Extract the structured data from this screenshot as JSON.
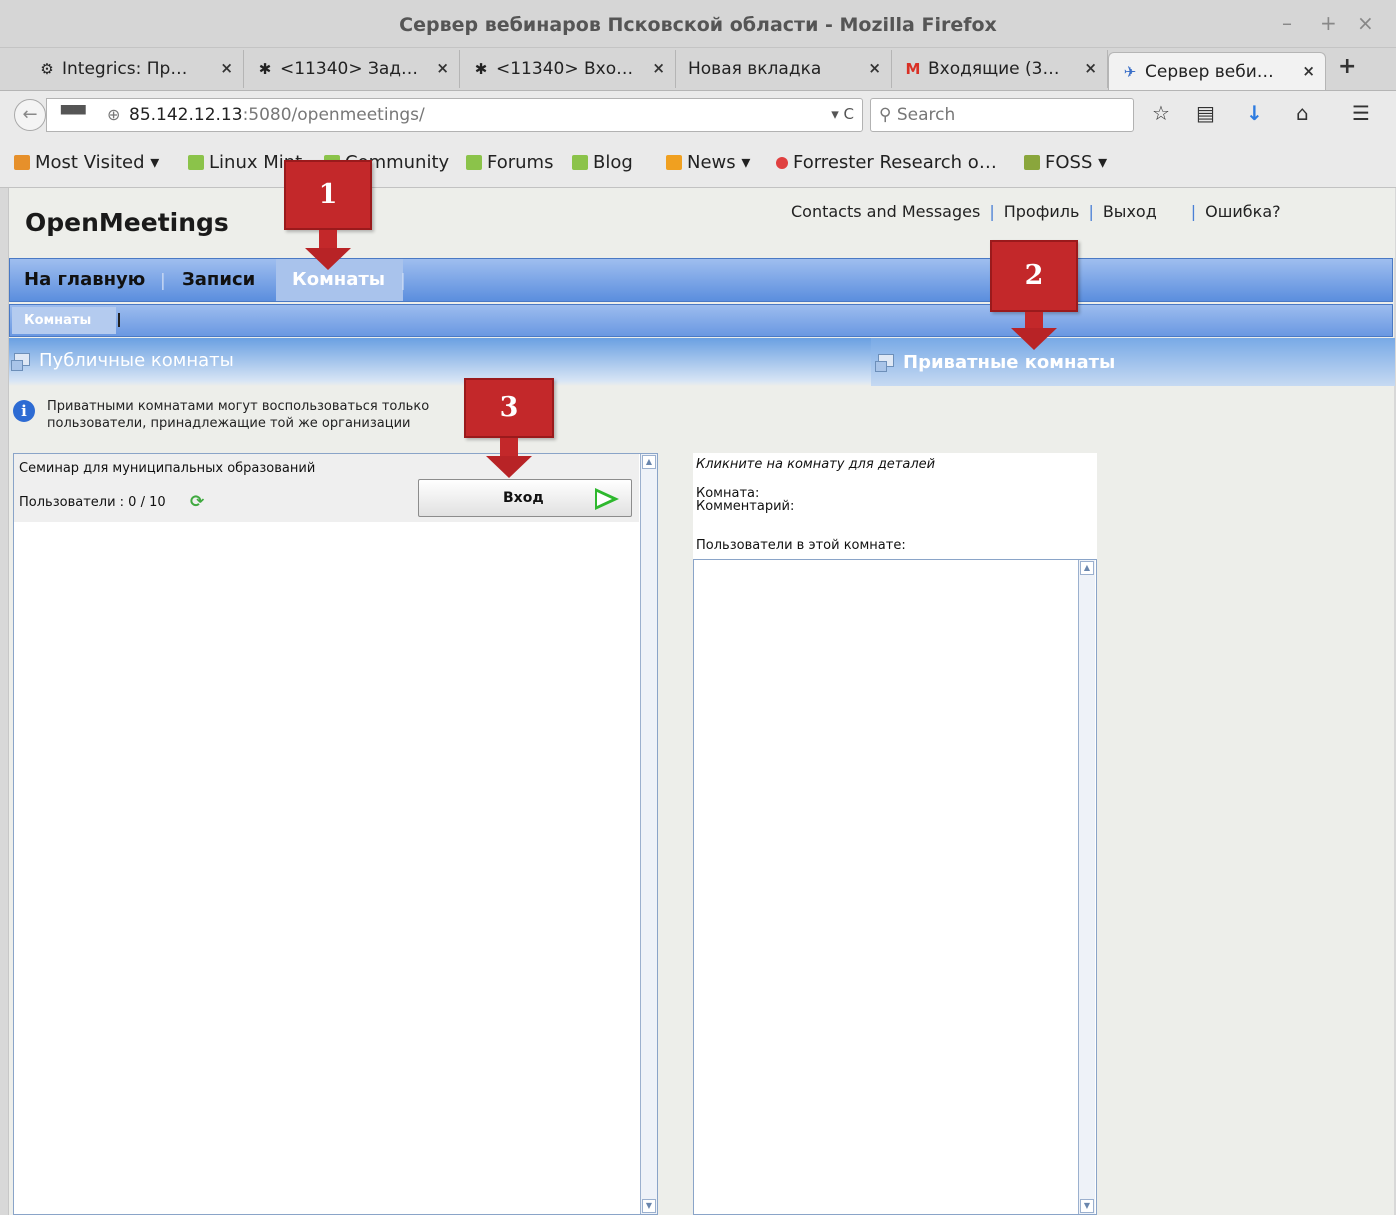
{
  "window": {
    "title": "Сервер вебинаров Псковской области - Mozilla Firefox",
    "controls": [
      "–",
      "+",
      "×"
    ]
  },
  "tabs": [
    {
      "label": "Integrics: Пр…",
      "icon": "integrics-icon"
    },
    {
      "label": "<11340> Зад…",
      "icon": "gear-icon"
    },
    {
      "label": "<11340> Вхо…",
      "icon": "gear-icon"
    },
    {
      "label": "Новая вкладка",
      "icon": ""
    },
    {
      "label": "Входящие (3…",
      "icon": "gmail-icon"
    },
    {
      "label": "Сервер веби…",
      "icon": "openmeetings-icon",
      "active": true
    }
  ],
  "navbar": {
    "url_host": "85.142.12.13",
    "url_rest": ":5080/openmeetings/",
    "search_placeholder": "Search"
  },
  "bookmarks": [
    {
      "label": "Most Visited ▾",
      "icon": "folder-icon",
      "color": "#e6902b"
    },
    {
      "label": "Linux Mint",
      "icon": "mint-icon",
      "color": "#8bc34a"
    },
    {
      "label": "Community",
      "icon": "mint-icon",
      "color": "#8bc34a"
    },
    {
      "label": "Forums",
      "icon": "mint-icon",
      "color": "#8bc34a"
    },
    {
      "label": "Blog",
      "icon": "mint-icon",
      "color": "#8bc34a"
    },
    {
      "label": "News ▾",
      "icon": "rss-icon",
      "color": "#f0a020"
    },
    {
      "label": "Forrester Research o…",
      "icon": "forrester-icon",
      "color": "#e04040"
    },
    {
      "label": "FOSS ▾",
      "icon": "folder-icon",
      "color": "#8aa63c"
    }
  ],
  "app": {
    "logo": "OpenMeetings",
    "toplinks": [
      "Contacts and Messages",
      "Профиль",
      "Выход",
      "Ошибка?"
    ],
    "mainnav": [
      "На главную",
      "Записи",
      "Комнаты"
    ],
    "subnav": [
      "Комнаты"
    ],
    "room_tabs": {
      "public": "Публичные комнаты",
      "private": "Приватные комнаты"
    },
    "info_line1": "Приватными комнатами могут воспользоваться только",
    "info_line2": "пользователи, принадлежащие той же организации",
    "room": {
      "name": "Семинар для муниципальных образований",
      "users": "Пользователи : 0 / 10",
      "enter_label": "Вход"
    },
    "details": {
      "hint": "Кликните на комнату для деталей",
      "room_label": "Комната:",
      "comment_label": "Комментарий:",
      "users_label": "Пользователи в этой комнате:"
    }
  },
  "annotations": [
    "1",
    "2",
    "3"
  ],
  "colors": {
    "accent": "#5b8ede",
    "callout": "#c3282a",
    "enter_arrow": "#2eb82e"
  }
}
